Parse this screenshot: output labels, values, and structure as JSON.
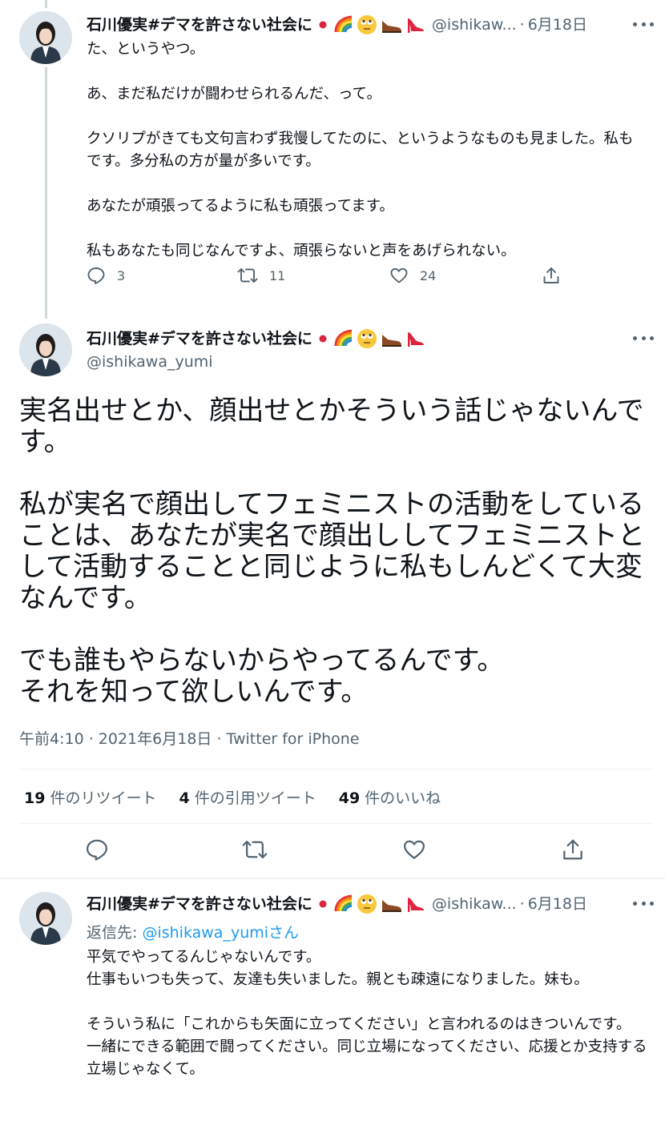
{
  "tweet1": {
    "name": "石川優実#デマを許さない社会に",
    "handle": "@ishikaw...",
    "date": "6月18日",
    "dot": "·",
    "text": "た、というやつ。\n\nあ、まだ私だけが闘わせられるんだ、って。\n\nクソリプがきても文句言わず我慢してたのに、というようなものも見ました。私もです。多分私の方が量が多いです。\n\nあなたが頑張ってるように私も頑張ってます。\n\n私もあなたも同じなんですよ、頑張らないと声をあげられない。",
    "reply_count": "3",
    "retweet_count": "11",
    "like_count": "24"
  },
  "tweet2": {
    "name": "石川優実#デマを許さない社会に",
    "handle": "@ishikawa_yumi",
    "text": "実名出せとか、顔出せとかそういう話じゃないんです。\n\n私が実名で顔出してフェミニストの活動をしていることは、あなたが実名で顔出ししてフェミニストとして活動することと同じように私もしんどくて大変なんです。\n\nでも誰もやらないからやってるんです。\nそれを知って欲しいんです。",
    "timestamp": "午前4:10 · 2021年6月18日 · Twitter for iPhone",
    "retweets_num": "19",
    "retweets_label": "件のリツイート",
    "quotes_num": "4",
    "quotes_label": "件の引用ツイート",
    "likes_num": "49",
    "likes_label": "件のいいね"
  },
  "tweet3": {
    "name": "石川優実#デマを許さない社会に",
    "handle": "@ishikaw...",
    "date": "6月18日",
    "dot": "·",
    "reply_prefix": "返信先: ",
    "reply_mention": "@ishikawa_yumi",
    "reply_suffix": "さん",
    "text": "平気でやってるんじゃないんです。\n仕事もいつも失って、友達も失いました。親とも疎遠になりました。妹も。\n\nそういう私に「これからも矢面に立ってください」と言われるのはきついんです。\n一緒にできる範囲で闘ってください。同じ立場になってください、応援とか支持する立場じゃなくて。"
  },
  "icons": [
    "japan-flag-icon",
    "rainbow-icon",
    "rolling-eyes-icon",
    "mens-shoe-icon",
    "high-heel-icon",
    "reply-icon",
    "retweet-icon",
    "like-icon",
    "share-icon",
    "more-icon"
  ],
  "colors": {
    "text": "#0f1419",
    "secondary": "#536471",
    "link": "#1d9bf0",
    "divider": "#eff3f4"
  }
}
